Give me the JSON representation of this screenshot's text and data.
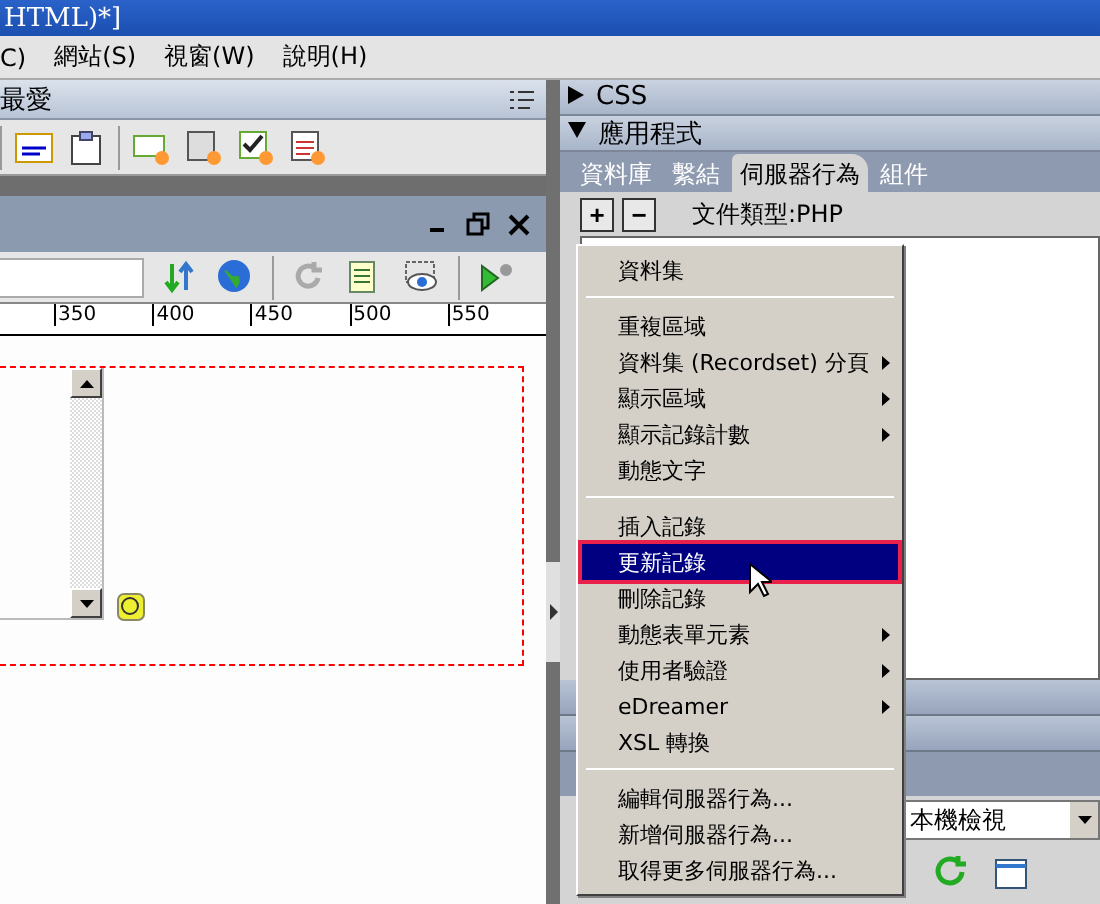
{
  "window": {
    "title": "HTML)*]"
  },
  "menu_bar": [
    "C)",
    "網站(S)",
    "視窗(W)",
    "說明(H)"
  ],
  "insert_bar": {
    "title": "最愛"
  },
  "document": {
    "ruler_ticks": [
      "350",
      "400",
      "450",
      "500",
      "550"
    ]
  },
  "panels": [
    {
      "title": "CSS",
      "expanded": false
    },
    {
      "title": "應用程式",
      "expanded": true
    }
  ],
  "tabs": [
    {
      "label": "資料庫",
      "selected": false
    },
    {
      "label": "繫結",
      "selected": false
    },
    {
      "label": "伺服器行為",
      "selected": true
    },
    {
      "label": "組件",
      "selected": false
    }
  ],
  "server_toolbar": {
    "buttons": [
      "+",
      "−"
    ],
    "doc_type": "文件類型:PHP"
  },
  "context_menu": [
    {
      "kind": "item",
      "label": "資料集",
      "submenu": false,
      "selected": false
    },
    {
      "kind": "separator"
    },
    {
      "kind": "item",
      "label": "重複區域",
      "submenu": false,
      "selected": false
    },
    {
      "kind": "item",
      "label": "資料集 (Recordset) 分頁",
      "submenu": true,
      "selected": false
    },
    {
      "kind": "item",
      "label": "顯示區域",
      "submenu": true,
      "selected": false
    },
    {
      "kind": "item",
      "label": "顯示記錄計數",
      "submenu": true,
      "selected": false
    },
    {
      "kind": "item",
      "label": "動態文字",
      "submenu": false,
      "selected": false
    },
    {
      "kind": "separator"
    },
    {
      "kind": "item",
      "label": "插入記錄",
      "submenu": false,
      "selected": false
    },
    {
      "kind": "item",
      "label": "更新記錄",
      "submenu": false,
      "selected": true
    },
    {
      "kind": "item",
      "label": "刪除記錄",
      "submenu": false,
      "selected": false
    },
    {
      "kind": "item",
      "label": "動態表單元素",
      "submenu": true,
      "selected": false
    },
    {
      "kind": "item",
      "label": "使用者驗證",
      "submenu": true,
      "selected": false
    },
    {
      "kind": "item",
      "label": "eDreamer",
      "submenu": true,
      "selected": false
    },
    {
      "kind": "item",
      "label": "XSL 轉換",
      "submenu": false,
      "selected": false
    },
    {
      "kind": "separator"
    },
    {
      "kind": "item",
      "label": "編輯伺服器行為...",
      "submenu": false,
      "selected": false
    },
    {
      "kind": "item",
      "label": "新增伺服器行為...",
      "submenu": false,
      "selected": false
    },
    {
      "kind": "item",
      "label": "取得更多伺服器行為...",
      "submenu": false,
      "selected": false
    }
  ],
  "site_view": {
    "value": "本機檢視"
  }
}
